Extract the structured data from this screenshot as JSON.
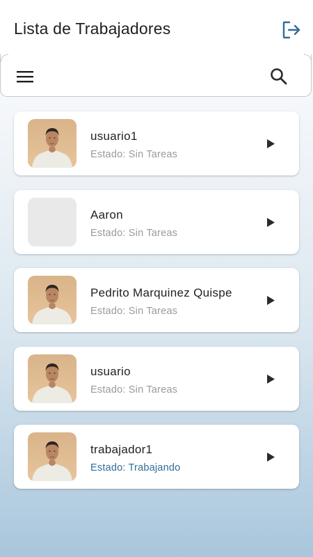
{
  "app": {
    "title": "Lista de Trabajadores"
  },
  "icons": {
    "logout": "logout-icon",
    "menu": "menu-icon",
    "search": "search-icon",
    "play": "play-arrow-icon",
    "avatar_placeholder": "avatar-placeholder"
  },
  "colors": {
    "accent": "#2f6e99",
    "status_default": "#9a9a9a",
    "status_active": "#2f6e99"
  },
  "workers": [
    {
      "name": "usuario1",
      "status": "Estado: Sin Tareas",
      "has_photo": true,
      "active": false
    },
    {
      "name": "Aaron",
      "status": "Estado: Sin Tareas",
      "has_photo": false,
      "active": false
    },
    {
      "name": "Pedrito Marquinez Quispe",
      "status": "Estado: Sin Tareas",
      "has_photo": true,
      "active": false
    },
    {
      "name": "usuario",
      "status": "Estado: Sin Tareas",
      "has_photo": true,
      "active": false
    },
    {
      "name": "trabajador1",
      "status": "Estado: Trabajando",
      "has_photo": true,
      "active": true
    }
  ]
}
